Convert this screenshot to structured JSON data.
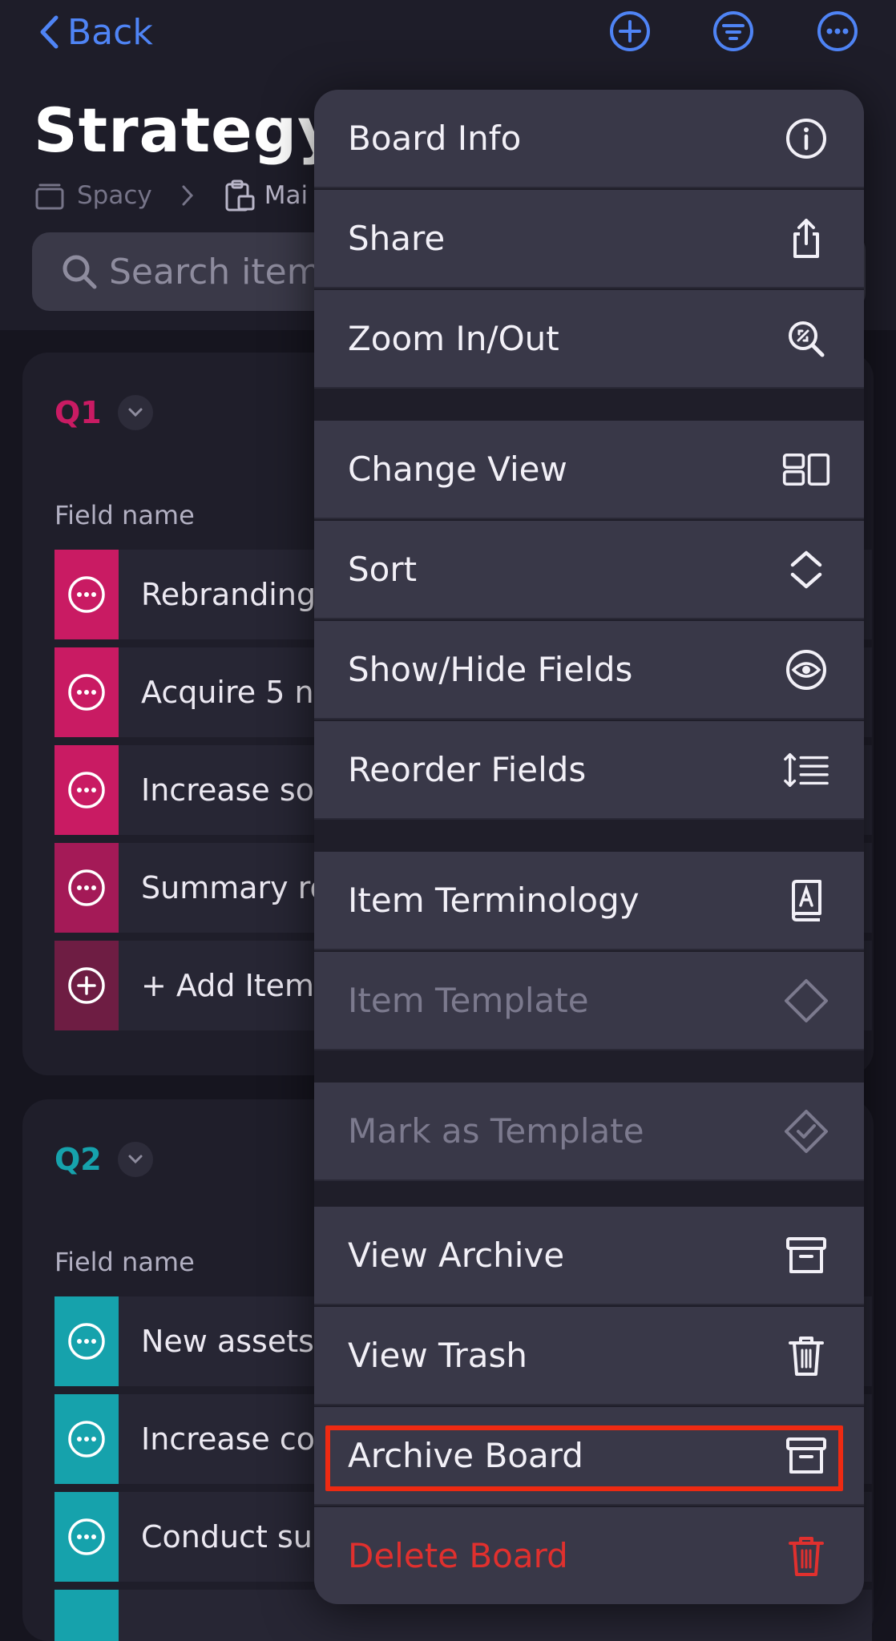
{
  "nav": {
    "back_label": "Back"
  },
  "board": {
    "title": "Strategy",
    "breadcrumb": {
      "space": "Spacy",
      "section": "Mai"
    },
    "search_placeholder": "Search item"
  },
  "groups": [
    {
      "label": "Q1",
      "color": "#c91b63",
      "field_name": "Field name",
      "items": [
        "Rebranding",
        "Acquire 5 n",
        "Increase so",
        "Summary ro"
      ],
      "add_label": "+ Add Item"
    },
    {
      "label": "Q2",
      "color": "#16a2ac",
      "field_name": "Field name",
      "items": [
        "New assets",
        "Increase co",
        "Conduct su"
      ]
    }
  ],
  "menu": {
    "items": [
      {
        "label": "Board Info",
        "icon": "info-icon",
        "state": "enabled"
      },
      {
        "label": "Share",
        "icon": "share-icon",
        "state": "enabled"
      },
      {
        "label": "Zoom In/Out",
        "icon": "zoom-icon",
        "state": "enabled"
      },
      {
        "label": "Change View",
        "icon": "layout-icon",
        "state": "enabled"
      },
      {
        "label": "Sort",
        "icon": "sort-icon",
        "state": "enabled"
      },
      {
        "label": "Show/Hide Fields",
        "icon": "eye-icon",
        "state": "enabled"
      },
      {
        "label": "Reorder Fields",
        "icon": "reorder-icon",
        "state": "enabled"
      },
      {
        "label": "Item Terminology",
        "icon": "dictionary-icon",
        "state": "enabled"
      },
      {
        "label": "Item Template",
        "icon": "diamond-icon",
        "state": "disabled"
      },
      {
        "label": "Mark as Template",
        "icon": "diamond-check-icon",
        "state": "disabled"
      },
      {
        "label": "View Archive",
        "icon": "archive-icon",
        "state": "enabled"
      },
      {
        "label": "View Trash",
        "icon": "trash-icon",
        "state": "enabled"
      },
      {
        "label": "Archive Board",
        "icon": "archive-icon",
        "state": "highlighted"
      },
      {
        "label": "Delete Board",
        "icon": "trash-icon",
        "state": "destructive"
      }
    ]
  },
  "colors": {
    "accent": "#4f84f5",
    "q1": "#c91b63",
    "q2": "#16a2ac",
    "danger": "#e0302e",
    "highlight": "#ee2a12"
  }
}
